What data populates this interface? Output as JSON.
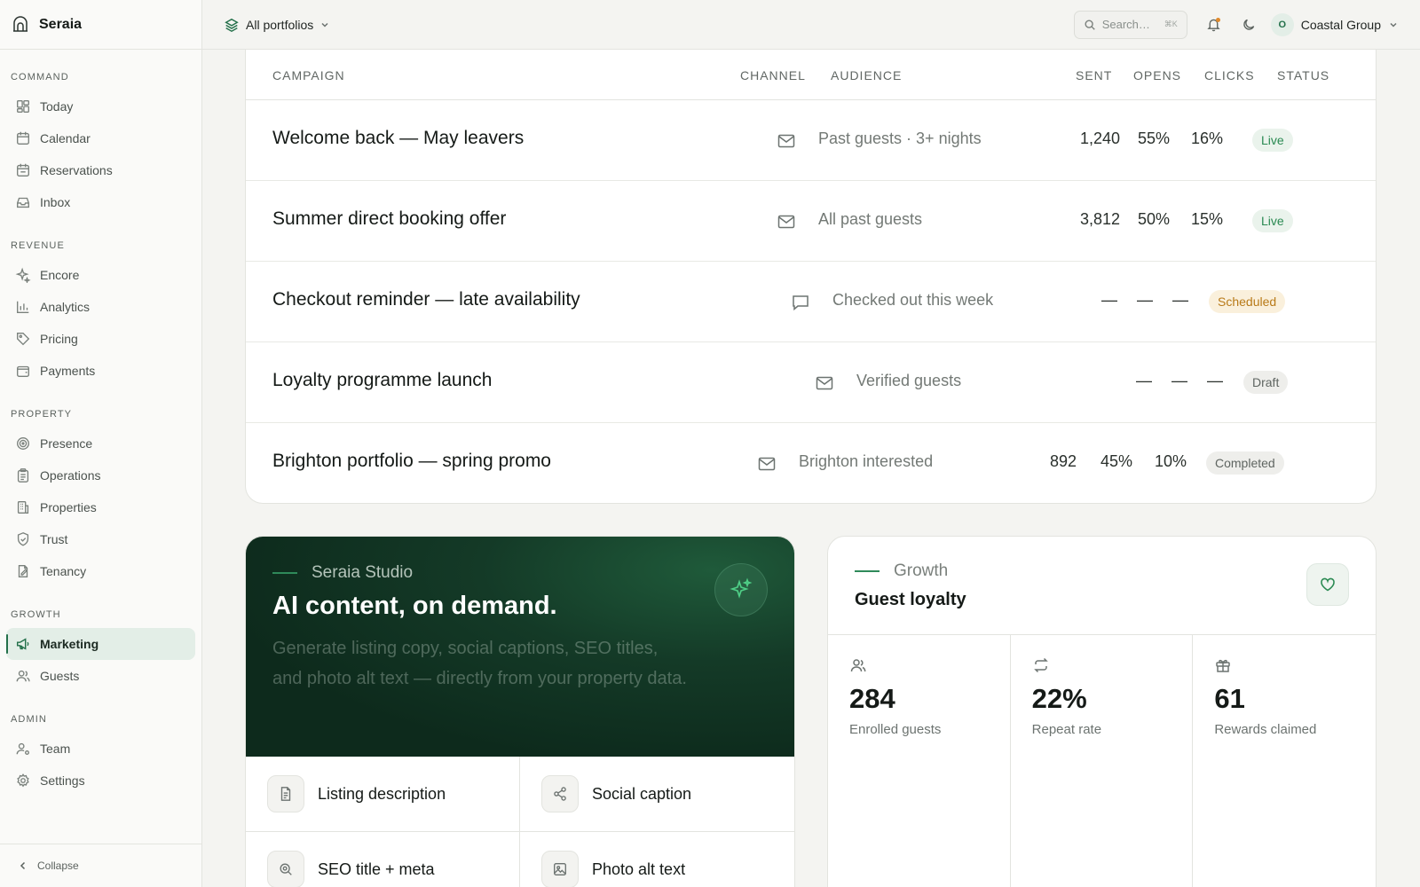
{
  "sidebar": {
    "brand": "Seraia",
    "groups": [
      {
        "label": "COMMAND",
        "items": [
          {
            "label": "Today",
            "icon": "dashboard-icon"
          },
          {
            "label": "Calendar",
            "icon": "calendar-icon"
          },
          {
            "label": "Reservations",
            "icon": "calendar-check-icon"
          },
          {
            "label": "Inbox",
            "icon": "inbox-icon"
          }
        ]
      },
      {
        "label": "REVENUE",
        "items": [
          {
            "label": "Encore",
            "icon": "sparkles-icon"
          },
          {
            "label": "Analytics",
            "icon": "bar-chart-icon"
          },
          {
            "label": "Pricing",
            "icon": "tag-icon"
          },
          {
            "label": "Payments",
            "icon": "wallet-icon"
          }
        ]
      },
      {
        "label": "PROPERTY",
        "items": [
          {
            "label": "Presence",
            "icon": "radar-icon"
          },
          {
            "label": "Operations",
            "icon": "clipboard-icon"
          },
          {
            "label": "Properties",
            "icon": "building-icon"
          },
          {
            "label": "Trust",
            "icon": "shield-check-icon"
          },
          {
            "label": "Tenancy",
            "icon": "file-edit-icon"
          }
        ]
      },
      {
        "label": "GROWTH",
        "items": [
          {
            "label": "Marketing",
            "icon": "megaphone-icon",
            "active": true
          },
          {
            "label": "Guests",
            "icon": "users-icon"
          }
        ]
      },
      {
        "label": "ADMIN",
        "items": [
          {
            "label": "Team",
            "icon": "user-cog-icon"
          },
          {
            "label": "Settings",
            "icon": "gear-icon"
          }
        ]
      }
    ],
    "collapse_label": "Collapse"
  },
  "topbar": {
    "portfolio": "All portfolios",
    "search_placeholder": "Search…",
    "search_shortcut": "⌘K",
    "account_initial": "O",
    "account_name": "Coastal Group"
  },
  "campaigns": {
    "headers": {
      "campaign": "CAMPAIGN",
      "channel": "CHANNEL",
      "audience": "AUDIENCE",
      "sent": "SENT",
      "opens": "OPENS",
      "clicks": "CLICKS",
      "status": "STATUS"
    },
    "rows": [
      {
        "name": "Welcome back — May leavers",
        "channel": "email",
        "audience": "Past guests · 3+ nights",
        "sent": "1,240",
        "opens": "55%",
        "clicks": "16%",
        "status": "Live"
      },
      {
        "name": "Summer direct booking offer",
        "channel": "email",
        "audience": "All past guests",
        "sent": "3,812",
        "opens": "50%",
        "clicks": "15%",
        "status": "Live"
      },
      {
        "name": "Checkout reminder — late availability",
        "channel": "sms",
        "audience": "Checked out this week",
        "sent": "—",
        "opens": "—",
        "clicks": "—",
        "status": "Scheduled"
      },
      {
        "name": "Loyalty programme launch",
        "channel": "email",
        "audience": "Verified guests",
        "sent": "—",
        "opens": "—",
        "clicks": "—",
        "status": "Draft"
      },
      {
        "name": "Brighton portfolio — spring promo",
        "channel": "email",
        "audience": "Brighton interested",
        "sent": "892",
        "opens": "45%",
        "clicks": "10%",
        "status": "Completed"
      }
    ]
  },
  "studio": {
    "eyebrow": "Seraia Studio",
    "title": "AI content, on demand.",
    "description": "Generate listing copy, social captions, SEO titles, and photo alt text — directly from your property data.",
    "tools": [
      {
        "label": "Listing description",
        "icon": "document-icon"
      },
      {
        "label": "Social caption",
        "icon": "share-icon"
      },
      {
        "label": "SEO title + meta",
        "icon": "search-zoom-icon"
      },
      {
        "label": "Photo alt text",
        "icon": "image-icon"
      }
    ]
  },
  "loyalty": {
    "eyebrow": "Growth",
    "title": "Guest loyalty",
    "stats": [
      {
        "value": "284",
        "label": "Enrolled guests",
        "icon": "users-icon"
      },
      {
        "value": "22%",
        "label": "Repeat rate",
        "icon": "repeat-icon"
      },
      {
        "value": "61",
        "label": "Rewards claimed",
        "icon": "gift-icon"
      }
    ]
  },
  "colors": {
    "accent": "#23704a",
    "live": "#2a8a52",
    "scheduled": "#b87a18",
    "hero": "#0d2a1c"
  }
}
